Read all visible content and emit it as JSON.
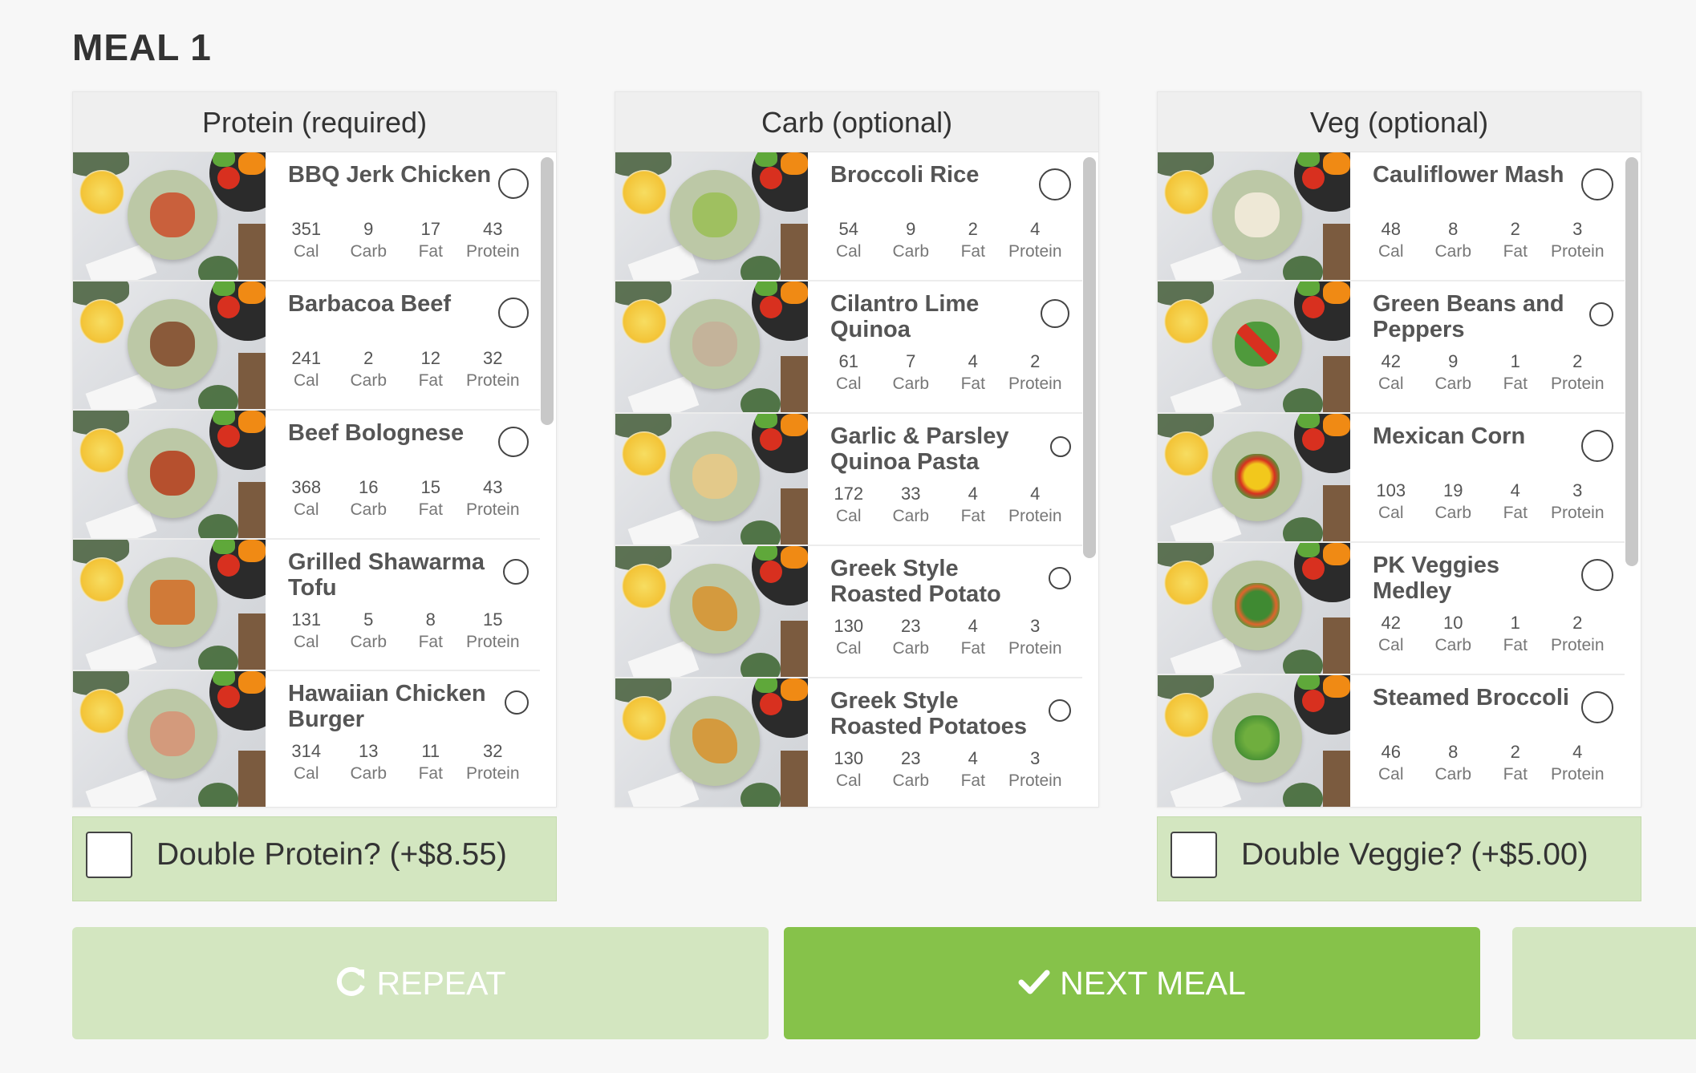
{
  "meal_title": "MEAL 1",
  "columns": [
    {
      "header": "Protein (required)",
      "items": [
        {
          "name": "BBQ Jerk Chicken",
          "cal": "351",
          "carb": "9",
          "fat": "17",
          "protein": "43"
        },
        {
          "name": "Barbacoa Beef",
          "cal": "241",
          "carb": "2",
          "fat": "12",
          "protein": "32"
        },
        {
          "name": "Beef Bolognese",
          "cal": "368",
          "carb": "16",
          "fat": "15",
          "protein": "43"
        },
        {
          "name": "Grilled Shawarma Tofu",
          "cal": "131",
          "carb": "5",
          "fat": "8",
          "protein": "15"
        },
        {
          "name": "Hawaiian Chicken Burger",
          "cal": "314",
          "carb": "13",
          "fat": "11",
          "protein": "32"
        }
      ]
    },
    {
      "header": "Carb (optional)",
      "items": [
        {
          "name": "Broccoli Rice",
          "cal": "54",
          "carb": "9",
          "fat": "2",
          "protein": "4"
        },
        {
          "name": "Cilantro Lime Quinoa",
          "cal": "61",
          "carb": "7",
          "fat": "4",
          "protein": "2"
        },
        {
          "name": "Garlic & Parsley Quinoa Pasta",
          "cal": "172",
          "carb": "33",
          "fat": "4",
          "protein": "4"
        },
        {
          "name": "Greek Style Roasted Potato",
          "cal": "130",
          "carb": "23",
          "fat": "4",
          "protein": "3"
        },
        {
          "name": "Greek Style Roasted Potatoes",
          "cal": "130",
          "carb": "23",
          "fat": "4",
          "protein": "3"
        }
      ]
    },
    {
      "header": "Veg (optional)",
      "items": [
        {
          "name": "Cauliflower Mash",
          "cal": "48",
          "carb": "8",
          "fat": "2",
          "protein": "3"
        },
        {
          "name": "Green Beans and Peppers",
          "cal": "42",
          "carb": "9",
          "fat": "1",
          "protein": "2"
        },
        {
          "name": "Mexican Corn",
          "cal": "103",
          "carb": "19",
          "fat": "4",
          "protein": "3"
        },
        {
          "name": "PK Veggies Medley",
          "cal": "42",
          "carb": "10",
          "fat": "1",
          "protein": "2"
        },
        {
          "name": "Steamed Broccoli",
          "cal": "46",
          "carb": "8",
          "fat": "2",
          "protein": "4"
        }
      ]
    }
  ],
  "macro_labels": {
    "cal": "Cal",
    "carb": "Carb",
    "fat": "Fat",
    "protein": "Protein"
  },
  "double_protein": {
    "label": "Double Protein? (+$8.55)",
    "checked": false
  },
  "double_veggie": {
    "label": "Double Veggie? (+$5.00)",
    "checked": false
  },
  "buttons": {
    "repeat": "REPEAT",
    "next_meal": "NEXT MEAL"
  },
  "icons": {
    "repeat": "refresh-icon",
    "next": "checkmark-icon"
  },
  "colors": {
    "accent": "#86c24a",
    "accent_light": "#d3e6c0",
    "background": "#f7f7f7"
  }
}
